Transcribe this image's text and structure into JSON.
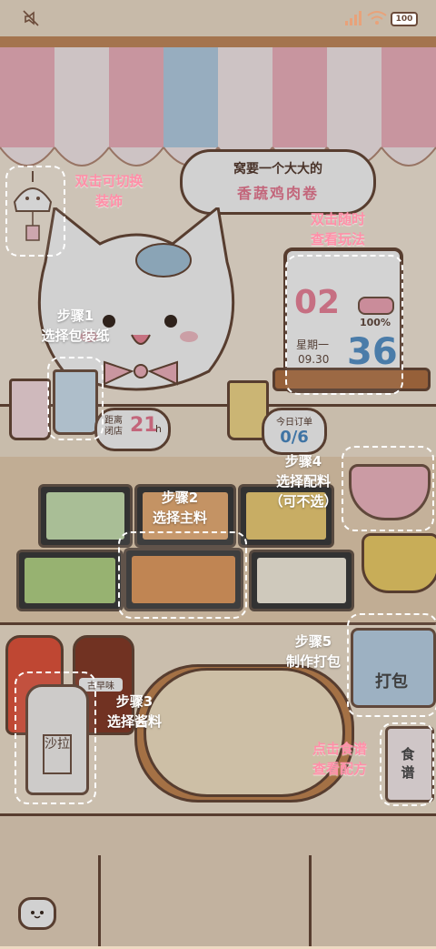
{
  "status_bar": {
    "battery_label": "100",
    "icons": [
      "mute-icon",
      "signal-icon",
      "wifi-icon",
      "battery-icon"
    ]
  },
  "order_bubble": {
    "line1": "窝要一个大大的",
    "line2": "香蔬鸡肉卷"
  },
  "shop_timer": {
    "label": "距离\n闭店",
    "value": "21",
    "unit": "h"
  },
  "daily_orders": {
    "label": "今日订单",
    "value": "0/6"
  },
  "calendar_board": {
    "day_number": "02",
    "battery_percent": "100%",
    "weekday": "星期一",
    "date": "09.30",
    "big_number": "36"
  },
  "sauce_bottles": {
    "salad_label": "沙拉",
    "other_label": "古早味"
  },
  "pack_box_label": "打包",
  "recipe_label": "食谱",
  "tips": {
    "decor": "双击可切换\n装饰",
    "rules": "双击随时\n查看玩法",
    "step1": "步骤1\n选择包装纸",
    "step2": "步骤2\n选择主料",
    "step3": "步骤3\n选择酱料",
    "step4": "步骤4\n选择配料\n（可不选）",
    "step5": "步骤5\n制作打包",
    "recipe": "点击食谱\n查看配方"
  },
  "colors": {
    "awning_pink": "#f4b6c2",
    "awning_blue": "#b9d4ea",
    "tip_pink": "#ff8fa8",
    "counter": "#f5e6d1",
    "wood": "#c98a55"
  }
}
